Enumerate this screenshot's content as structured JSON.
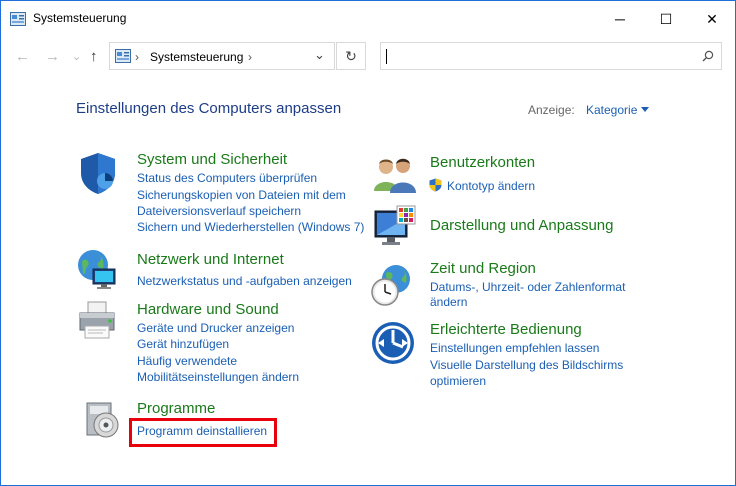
{
  "window": {
    "title": "Systemsteuerung"
  },
  "titlebar": {
    "minimize": "─",
    "maximize": "☐",
    "close": "✕"
  },
  "navbar": {
    "back": "←",
    "forward": "→",
    "dropdown": "⌄",
    "up": "↑",
    "breadcrumb_sep1": "›",
    "breadcrumb_item": "Systemsteuerung",
    "breadcrumb_sep2": "›",
    "address_dropdown": "⌄",
    "refresh": "↻",
    "search_icon": "⌕",
    "search_value": ""
  },
  "header": {
    "title": "Einstellungen des Computers anpassen",
    "view_label": "Anzeige:",
    "view_value": "Kategorie"
  },
  "categories": {
    "system": {
      "title": "System und Sicherheit",
      "links": [
        "Status des Computers überprüfen",
        "Sicherungskopien von Dateien mit dem",
        "Dateiversionsverlauf speichern",
        "Sichern und Wiederherstellen (Windows 7)"
      ]
    },
    "network": {
      "title": "Netzwerk und Internet",
      "links": [
        "Netzwerkstatus und -aufgaben anzeigen"
      ]
    },
    "hardware": {
      "title": "Hardware und Sound",
      "links": [
        "Geräte und Drucker anzeigen",
        "Gerät hinzufügen",
        "Häufig verwendete",
        "Mobilitätseinstellungen ändern"
      ]
    },
    "programs": {
      "title": "Programme",
      "links": [
        "Programm deinstallieren"
      ]
    },
    "accounts": {
      "title": "Benutzerkonten",
      "links": [
        "Kontotyp ändern"
      ]
    },
    "appearance": {
      "title": "Darstellung und Anpassung",
      "links": []
    },
    "clock": {
      "title": "Zeit und Region",
      "links": [
        "Datums-, Uhrzeit- oder Zahlenformat",
        "ändern"
      ]
    },
    "ease": {
      "title": "Erleichterte Bedienung",
      "links": [
        "Einstellungen empfehlen lassen",
        "Visuelle Darstellung des Bildschirms",
        "optimieren"
      ]
    }
  },
  "colors": {
    "title_green": "#1a7a1a",
    "link_blue": "#1a5fb4",
    "heading_blue": "#1e3d87",
    "highlight_red": "#e8000b",
    "window_border": "#1e6fd9"
  },
  "icons": [
    "control-panel-icon",
    "shield-icon",
    "network-globe-icon",
    "printer-icon",
    "programs-disk-icon",
    "users-icon",
    "uac-shield-icon",
    "display-palette-icon",
    "clock-globe-icon",
    "ease-of-access-icon"
  ]
}
